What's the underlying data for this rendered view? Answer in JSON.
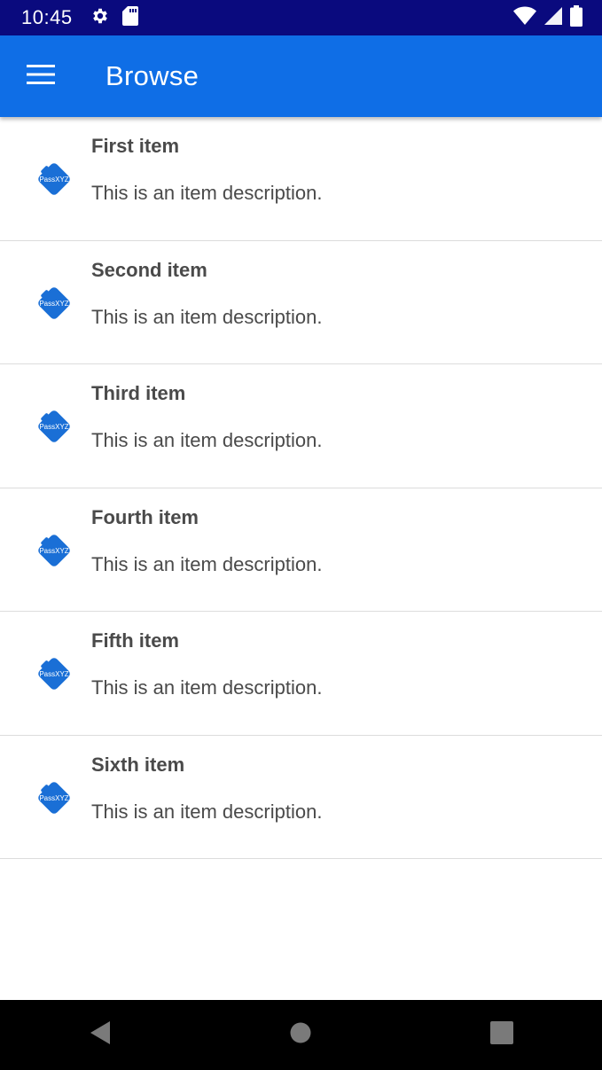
{
  "status_bar": {
    "time": "10:45",
    "icons": [
      "gear-icon",
      "sd-card-icon",
      "wifi-icon",
      "signal-icon",
      "battery-icon"
    ]
  },
  "app_bar": {
    "title": "Browse",
    "menu_icon": "hamburger-menu-icon",
    "color": "#0f6ee6"
  },
  "items": [
    {
      "title": "First item",
      "description": "This is an item description.",
      "icon": "passxyz-logo-icon",
      "icon_text": "PassXYZ"
    },
    {
      "title": "Second item",
      "description": "This is an item description.",
      "icon": "passxyz-logo-icon",
      "icon_text": "PassXYZ"
    },
    {
      "title": "Third item",
      "description": "This is an item description.",
      "icon": "passxyz-logo-icon",
      "icon_text": "PassXYZ"
    },
    {
      "title": "Fourth item",
      "description": "This is an item description.",
      "icon": "passxyz-logo-icon",
      "icon_text": "PassXYZ"
    },
    {
      "title": "Fifth item",
      "description": "This is an item description.",
      "icon": "passxyz-logo-icon",
      "icon_text": "PassXYZ"
    },
    {
      "title": "Sixth item",
      "description": "This is an item description.",
      "icon": "passxyz-logo-icon",
      "icon_text": "PassXYZ"
    }
  ],
  "nav_bar": {
    "icons": [
      "back-icon",
      "home-icon",
      "recents-icon"
    ]
  },
  "colors": {
    "status_bar": "#0a0a7e",
    "accent": "#0f6ee6",
    "text": "#4a4a4a",
    "divider": "#dcdcdc"
  }
}
